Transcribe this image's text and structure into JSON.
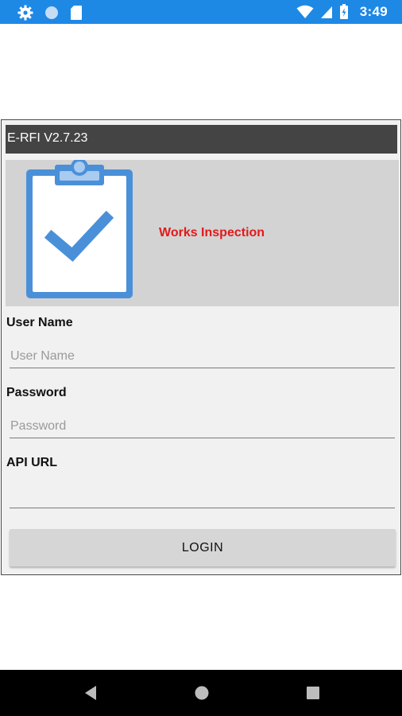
{
  "status_bar": {
    "time": "3:49",
    "icons": [
      "gear-icon",
      "circle-icon",
      "sd-card-icon",
      "wifi-icon",
      "cell-signal-icon",
      "battery-icon"
    ]
  },
  "dialog": {
    "title": "E-RFI V2.7.23",
    "banner_text": "Works Inspection",
    "logo_icon": "clipboard-check-icon",
    "accent_color": "#e21a1a",
    "fields": {
      "username": {
        "label": "User Name",
        "placeholder": "User Name",
        "value": ""
      },
      "password": {
        "label": "Password",
        "placeholder": "Password",
        "value": ""
      },
      "api_url": {
        "label": "API URL",
        "placeholder": "",
        "value": ""
      }
    },
    "login_label": "LOGIN"
  },
  "nav_bar": {
    "icons": [
      "back-icon",
      "home-icon",
      "recents-icon"
    ]
  },
  "colors": {
    "status_bar": "#1e88e5",
    "title_bar": "#444444",
    "banner": "#d3d3d3",
    "dialog_bg": "#f1f1f1"
  }
}
